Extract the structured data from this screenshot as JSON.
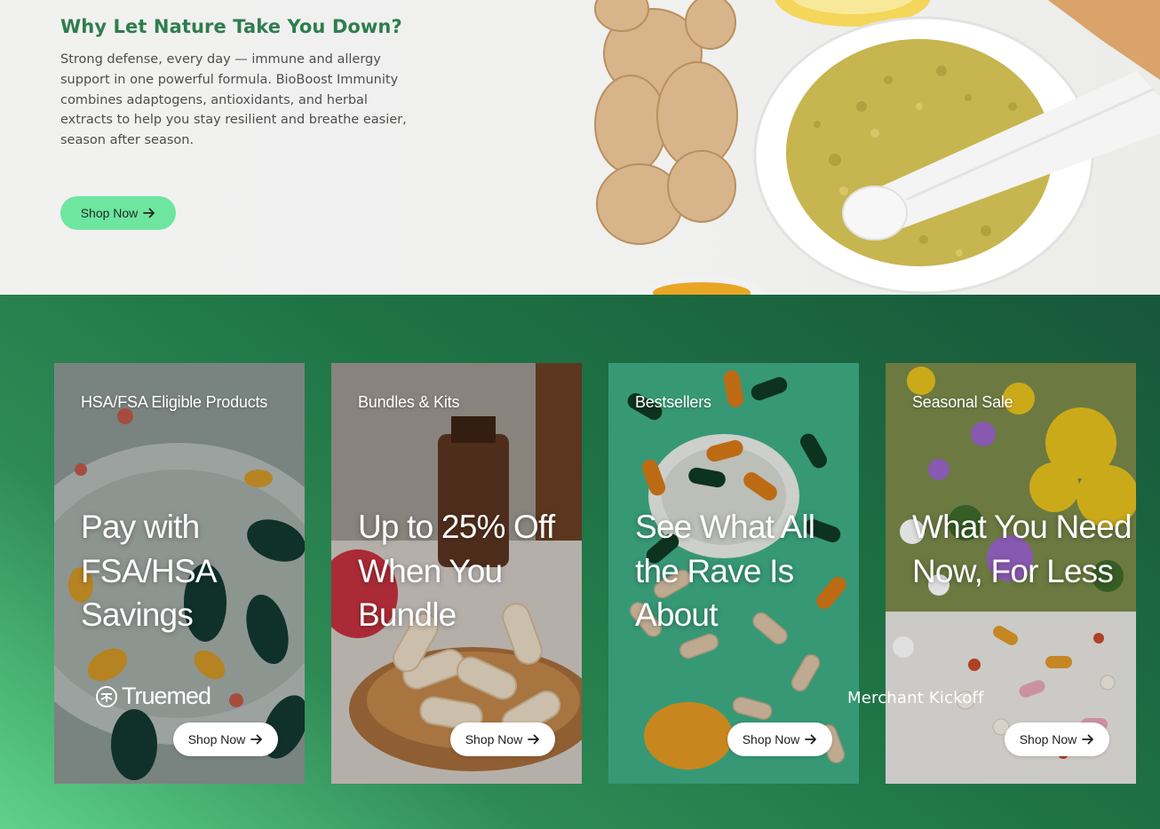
{
  "hero": {
    "title": "Why Let Nature Take You Down?",
    "body": "Strong defense, every day — immune and allergy support in one powerful formula. BioBoost Immunity combines adaptogens, antioxidants, and herbal extracts to help you stay resilient and breathe easier, season after season.",
    "button_label": "Shop Now",
    "button_icon": "arrow-right-icon",
    "button_color": "#6ee6a0",
    "title_color": "#2f7d4e"
  },
  "promos": [
    {
      "tag": "HSA/FSA Eligible Products",
      "headline": "Pay with FSA/HSA Savings",
      "button_label": "Shop Now",
      "brand_label": "Truemed"
    },
    {
      "tag": "Bundles & Kits",
      "headline": "Up to 25% Off When You Bundle",
      "button_label": "Shop Now"
    },
    {
      "tag": "Bestsellers",
      "headline": "See What All the Rave Is About",
      "button_label": "Shop Now"
    },
    {
      "tag": "Seasonal Sale",
      "headline": "What You Need Now, For Less",
      "button_label": "Shop Now"
    }
  ],
  "watermark": "Merchant Kickoff",
  "colors": {
    "section_green": "#1f7445",
    "section_green_light": "#5fd28c"
  }
}
